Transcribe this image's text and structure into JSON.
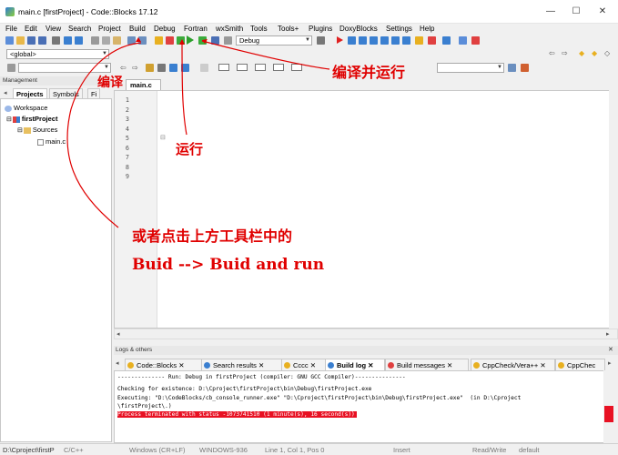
{
  "window": {
    "title": "main.c [firstProject] - Code::Blocks 17.12",
    "controls": {
      "minimize": "—",
      "maximize": "☐",
      "close": "✕"
    }
  },
  "menu": [
    "File",
    "Edit",
    "View",
    "Search",
    "Project",
    "Build",
    "Debug",
    "Fortran",
    "wxSmith",
    "Tools",
    "Tools+",
    "Plugins",
    "DoxyBlocks",
    "Settings",
    "Help"
  ],
  "toolbar": {
    "build_target": "Debug",
    "scope": "<global>"
  },
  "management": {
    "header": "Management",
    "tabs": [
      "Projects",
      "Symbols",
      "Fi"
    ],
    "tree": [
      {
        "label": "Workspace",
        "level": 0
      },
      {
        "label": "firstProject",
        "level": 1
      },
      {
        "label": "Sources",
        "level": 2
      },
      {
        "label": "main.c",
        "level": 3
      }
    ]
  },
  "editor": {
    "tab_label": "main.c",
    "lines": [
      "1",
      "2",
      "3",
      "4",
      "5",
      "6",
      "7",
      "8",
      "9"
    ]
  },
  "logs": {
    "header": "Logs & others",
    "tabs": [
      "Code::Blocks",
      "Search results",
      "Cccc",
      "Build log",
      "Build messages",
      "CppCheck/Vera++",
      "CppChec"
    ],
    "lines": [
      "-------------- Run: Debug in firstProject (compiler: GNU GCC Compiler)---------------",
      "Checking for existence: D:\\Cproject\\firstProject\\bin\\Debug\\firstProject.exe",
      "Executing: \"D:\\CodeBlocks/cb_console_runner.exe\" \"D:\\Cproject\\firstProject\\bin\\Debug\\firstProject.exe\"  (in D:\\Cproject",
      "\\firstProject\\.)",
      "Process terminated with status -1073741510 (1 minute(s), 16 second(s))"
    ]
  },
  "statusbar": {
    "path": "D:\\Cproject\\firstP",
    "lang": "C/C++",
    "eol": "Windows (CR+LF)",
    "encoding": "WINDOWS-936",
    "position": "Line 1, Col 1, Pos 0",
    "mode": "Insert",
    "access": "Read/Write",
    "profile": "default"
  },
  "annotations": {
    "build": "编译",
    "run": "运行",
    "build_and_run": "编译并运行",
    "hint_cn": "或者点击上方工具栏中的",
    "hint_en": "Buid --> Buid and run"
  },
  "colors": {
    "annotation": "#e00000",
    "error_line_bg": "#e81123",
    "preprocessor": "#2a7a2a",
    "keyword": "#0000a0",
    "string": "#0000ff"
  }
}
